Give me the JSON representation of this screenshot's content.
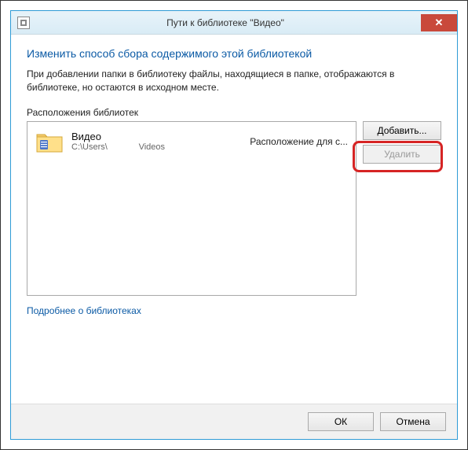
{
  "titlebar": {
    "title": "Пути к библиотеке \"Видео\""
  },
  "heading": "Изменить способ сбора содержимого этой библиотекой",
  "description": "При добавлении папки в библиотеку файлы, находящиеся в папке, отображаются в библиотеке, но остаются в исходном месте.",
  "section_label": "Расположения библиотек",
  "list": {
    "items": [
      {
        "name": "Видео",
        "path": "C:\\Users\\             Videos",
        "location": "Расположение для с..."
      }
    ]
  },
  "buttons": {
    "add": "Добавить...",
    "remove": "Удалить",
    "ok": "ОК",
    "cancel": "Отмена"
  },
  "link": "Подробнее о библиотеках"
}
